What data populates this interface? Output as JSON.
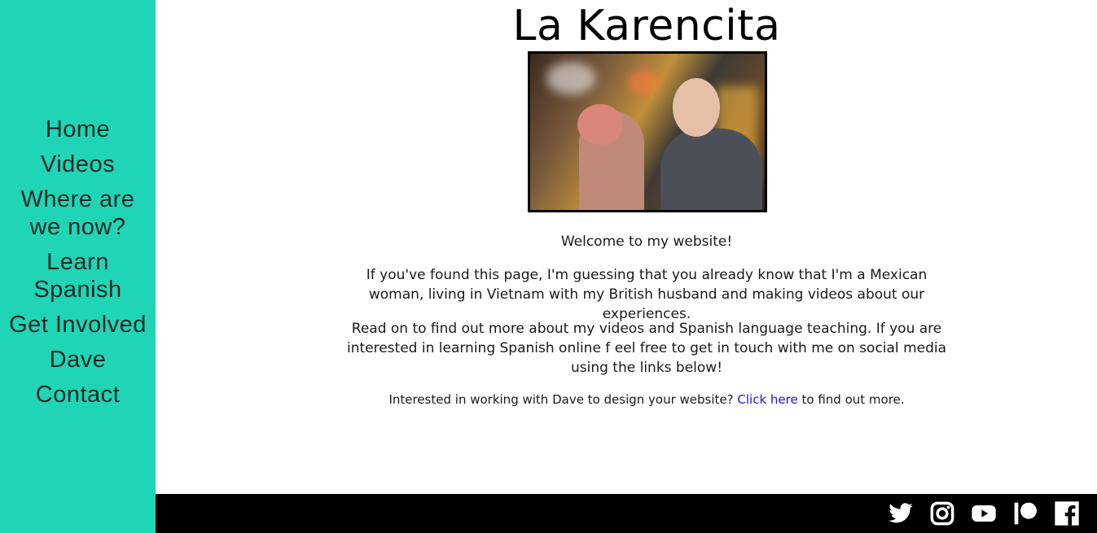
{
  "site": {
    "title": "La Karencita"
  },
  "nav": {
    "items": [
      {
        "label": "Home"
      },
      {
        "label": "Videos"
      },
      {
        "label": "Where are we now?"
      },
      {
        "label": "Learn Spanish"
      },
      {
        "label": "Get Involved"
      },
      {
        "label": "Dave"
      },
      {
        "label": "Contact"
      }
    ]
  },
  "content": {
    "welcome": "Welcome to my website!",
    "intro": "If you've found this page, I'm guessing that you already know that I'm a Mexican woman, living in Vietnam with my British husband and making videos about our experiences.",
    "read_on": "Read on to find out more about my videos and Spanish language teaching. If you are interested in learning Spanish online f eel free to get in touch with me on social media using the links below!",
    "dave_prefix": "Interested in working with Dave to design your website?",
    "dave_link": "Click here",
    "dave_suffix": "to find out more."
  },
  "footer": {
    "socials": [
      "twitter-icon",
      "instagram-icon",
      "youtube-icon",
      "patreon-icon",
      "facebook-icon"
    ]
  },
  "colors": {
    "sidebar": "#1fd5b5",
    "footer": "#000000",
    "link": "#1a1ad6"
  }
}
